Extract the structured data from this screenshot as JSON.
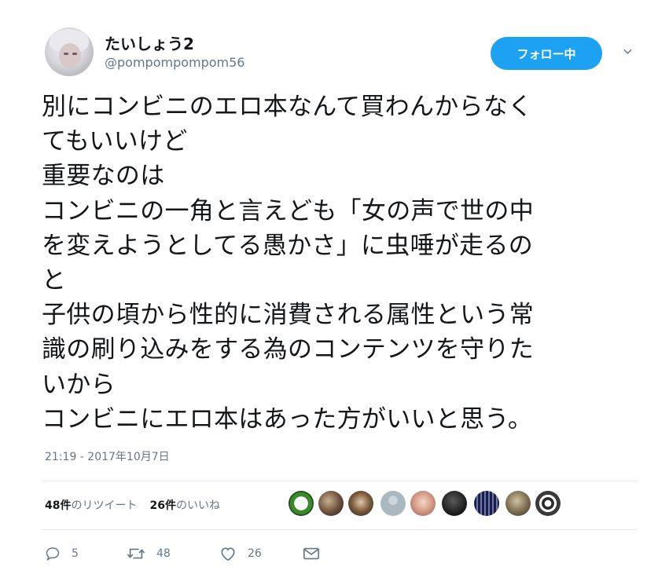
{
  "user": {
    "display_name": "たいしょう2",
    "handle": "@pompompompom56",
    "avatar_icon": "avatar-image"
  },
  "follow_button": {
    "label": "フォロー中"
  },
  "tweet": {
    "lines": [
      "別にコンビニのエロ本なんて買わんからなく",
      "てもいいけど",
      "重要なのは",
      "コンビニの一角と言えども「女の声で世の中",
      "を変えようとしてる愚かさ」に虫唾が走るの",
      "と",
      "子供の頃から性的に消費される属性という常",
      "識の刷り込みをする為のコンテンツを守りた",
      "いから",
      "コンビニにエロ本はあった方がいいと思う。"
    ],
    "timestamp": "21:19 - 2017年10月7日"
  },
  "stats": {
    "retweets_count": "48件",
    "retweets_label": "のリツイート",
    "likes_count": "26件",
    "likes_label": "のいいね"
  },
  "actions": {
    "reply_count": "5",
    "retweet_count": "48",
    "like_count": "26"
  },
  "colors": {
    "accent": "#1da1f2",
    "text": "#14171a",
    "muted": "#657786",
    "divider": "#e6ecf0"
  }
}
